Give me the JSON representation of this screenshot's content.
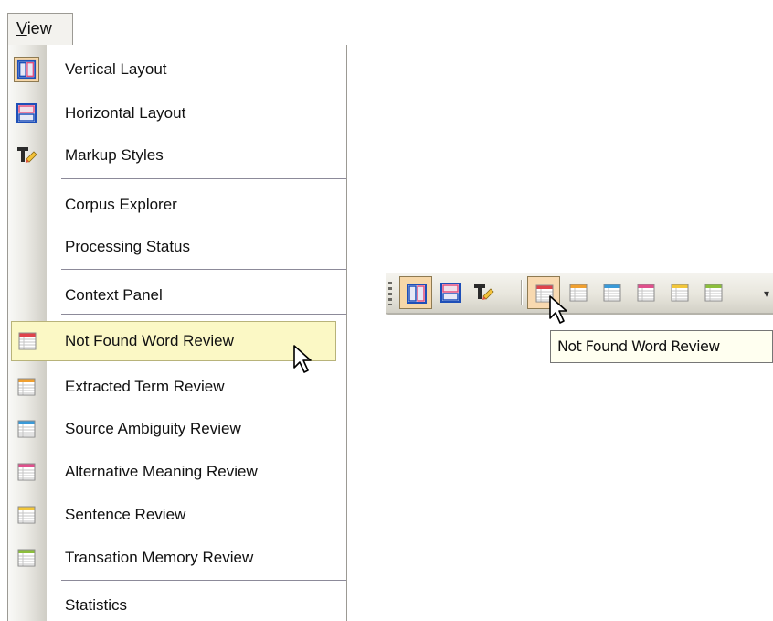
{
  "menu": {
    "title": "View",
    "title_accel": "V",
    "title_rest": "iew",
    "items": [
      {
        "label": "Vertical Layout",
        "icon": "vertical-layout-icon"
      },
      {
        "label": "Horizontal Layout",
        "icon": "horizontal-layout-icon"
      },
      {
        "label": "Markup Styles",
        "icon": "markup-styles-icon"
      },
      {
        "label": "Corpus Explorer",
        "icon": ""
      },
      {
        "label": "Processing Status",
        "icon": ""
      },
      {
        "label": "Context Panel",
        "icon": ""
      },
      {
        "label": "Not Found Word Review",
        "icon": "review-table-red-icon"
      },
      {
        "label": "Extracted Term Review",
        "icon": "review-table-orange-icon"
      },
      {
        "label": "Source Ambiguity Review",
        "icon": "review-table-blue-icon"
      },
      {
        "label": "Alternative Meaning Review",
        "icon": "review-table-pink-icon"
      },
      {
        "label": "Sentence Review",
        "icon": "review-table-yellow-icon"
      },
      {
        "label": "Transation Memory Review",
        "icon": "review-table-green-icon"
      },
      {
        "label": "Statistics",
        "icon": ""
      }
    ],
    "highlighted_item": "Not Found Word Review"
  },
  "toolbar": {
    "buttons": [
      {
        "name": "vertical-layout-button",
        "icon": "vertical-layout-icon",
        "state": "checked"
      },
      {
        "name": "horizontal-layout-button",
        "icon": "horizontal-layout-icon",
        "state": "normal"
      },
      {
        "name": "markup-styles-button",
        "icon": "markup-styles-icon",
        "state": "normal"
      },
      {
        "name": "not-found-word-review-button",
        "icon": "review-table-red-icon",
        "state": "hover"
      },
      {
        "name": "extracted-term-review-button",
        "icon": "review-table-orange-icon",
        "state": "normal"
      },
      {
        "name": "source-ambiguity-review-button",
        "icon": "review-table-blue-icon",
        "state": "normal"
      },
      {
        "name": "alternative-meaning-review-button",
        "icon": "review-table-pink-icon",
        "state": "normal"
      },
      {
        "name": "sentence-review-button",
        "icon": "review-table-yellow-icon",
        "state": "normal"
      },
      {
        "name": "translation-memory-review-button",
        "icon": "review-table-green-icon",
        "state": "normal"
      }
    ]
  },
  "tooltip": {
    "text": "Not Found Word Review"
  },
  "colors": {
    "highlight_bg": "#fbf8c5",
    "toolbar_checked": "#f6d7a8",
    "review_red": "#e0434b",
    "review_orange": "#f0a030",
    "review_blue": "#3a9ad8",
    "review_pink": "#e0508c",
    "review_yellow": "#f2c63a",
    "review_green": "#8cbf3c"
  }
}
